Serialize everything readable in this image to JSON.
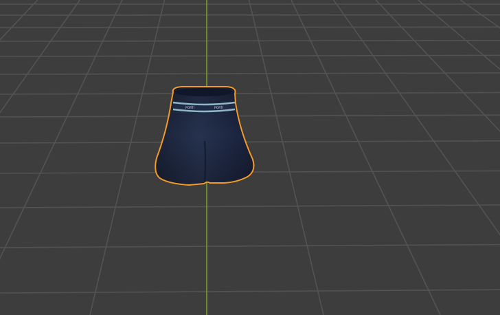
{
  "viewport": {
    "background_color": "#3d3d3d",
    "grid_line_color": "#535353",
    "y_axis_color": "#6b8e2a",
    "selection_outline_color": "#f59a27",
    "selected_object": "shorts"
  },
  "object": {
    "fabric_color": "#1f2a44",
    "waistband_stripe_color": "#8fb6c9",
    "waistband_text": "PORTI"
  }
}
